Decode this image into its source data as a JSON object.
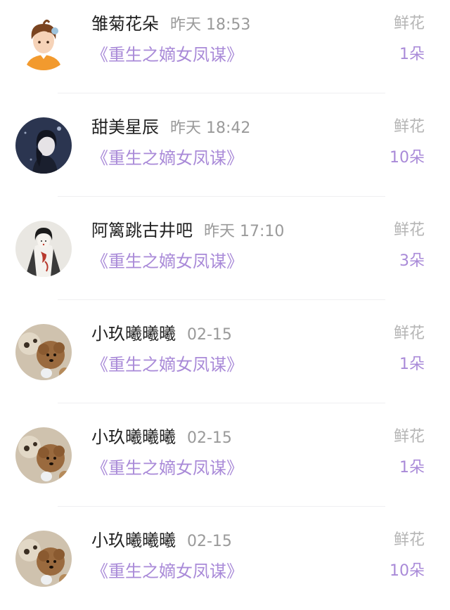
{
  "gifts": [
    {
      "avatar": "cartoon-boy-avatar",
      "name": "雏菊花朵",
      "time": "昨天 18:53",
      "book": "《重生之嫡女凤谋》",
      "gift_type": "鲜花",
      "count": "1朵"
    },
    {
      "avatar": "night-girl-avatar",
      "name": "甜美星辰",
      "time": "昨天 18:42",
      "book": "《重生之嫡女凤谋》",
      "gift_type": "鲜花",
      "count": "10朵"
    },
    {
      "avatar": "ink-painting-avatar",
      "name": "阿篱跳古井吧",
      "time": "昨天 17:10",
      "book": "《重生之嫡女凤谋》",
      "gift_type": "鲜花",
      "count": "3朵"
    },
    {
      "avatar": "teddy-dog-avatar",
      "name": "小玖曦曦曦",
      "time": "02-15",
      "book": "《重生之嫡女凤谋》",
      "gift_type": "鲜花",
      "count": "1朵"
    },
    {
      "avatar": "teddy-dog-avatar",
      "name": "小玖曦曦曦",
      "time": "02-15",
      "book": "《重生之嫡女凤谋》",
      "gift_type": "鲜花",
      "count": "1朵"
    },
    {
      "avatar": "teddy-dog-avatar",
      "name": "小玖曦曦曦",
      "time": "02-15",
      "book": "《重生之嫡女凤谋》",
      "gift_type": "鲜花",
      "count": "10朵"
    }
  ],
  "colors": {
    "accent": "#a98ad8",
    "name_text": "#222222",
    "time_text": "#9a9a9a",
    "gift_type_text": "#b5b5b5"
  }
}
